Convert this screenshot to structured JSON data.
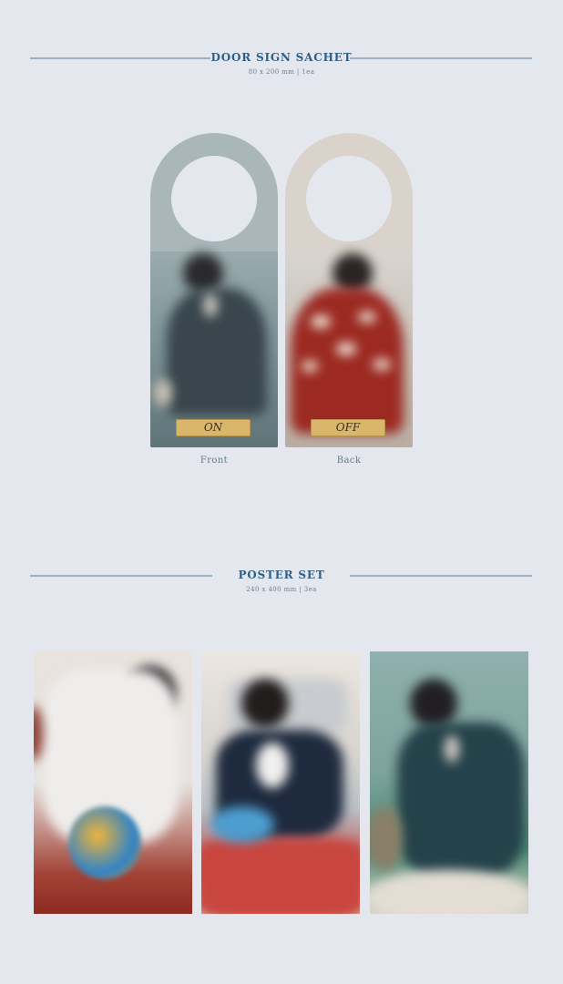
{
  "door_sign": {
    "title": "DOOR SIGN SACHET",
    "spec": "80 x 200 mm | 1ea",
    "front": {
      "tag_label": "ON",
      "caption": "Front"
    },
    "back": {
      "tag_label": "OFF",
      "caption": "Back"
    }
  },
  "poster_set": {
    "title": "POSTER SET",
    "spec": "240 x 400 mm | 3ea"
  },
  "colors": {
    "background": "#e4e8ee",
    "accent_text": "#2f5f86",
    "rule": "#9bb3c6",
    "tag_gold": "#d9b66a"
  }
}
